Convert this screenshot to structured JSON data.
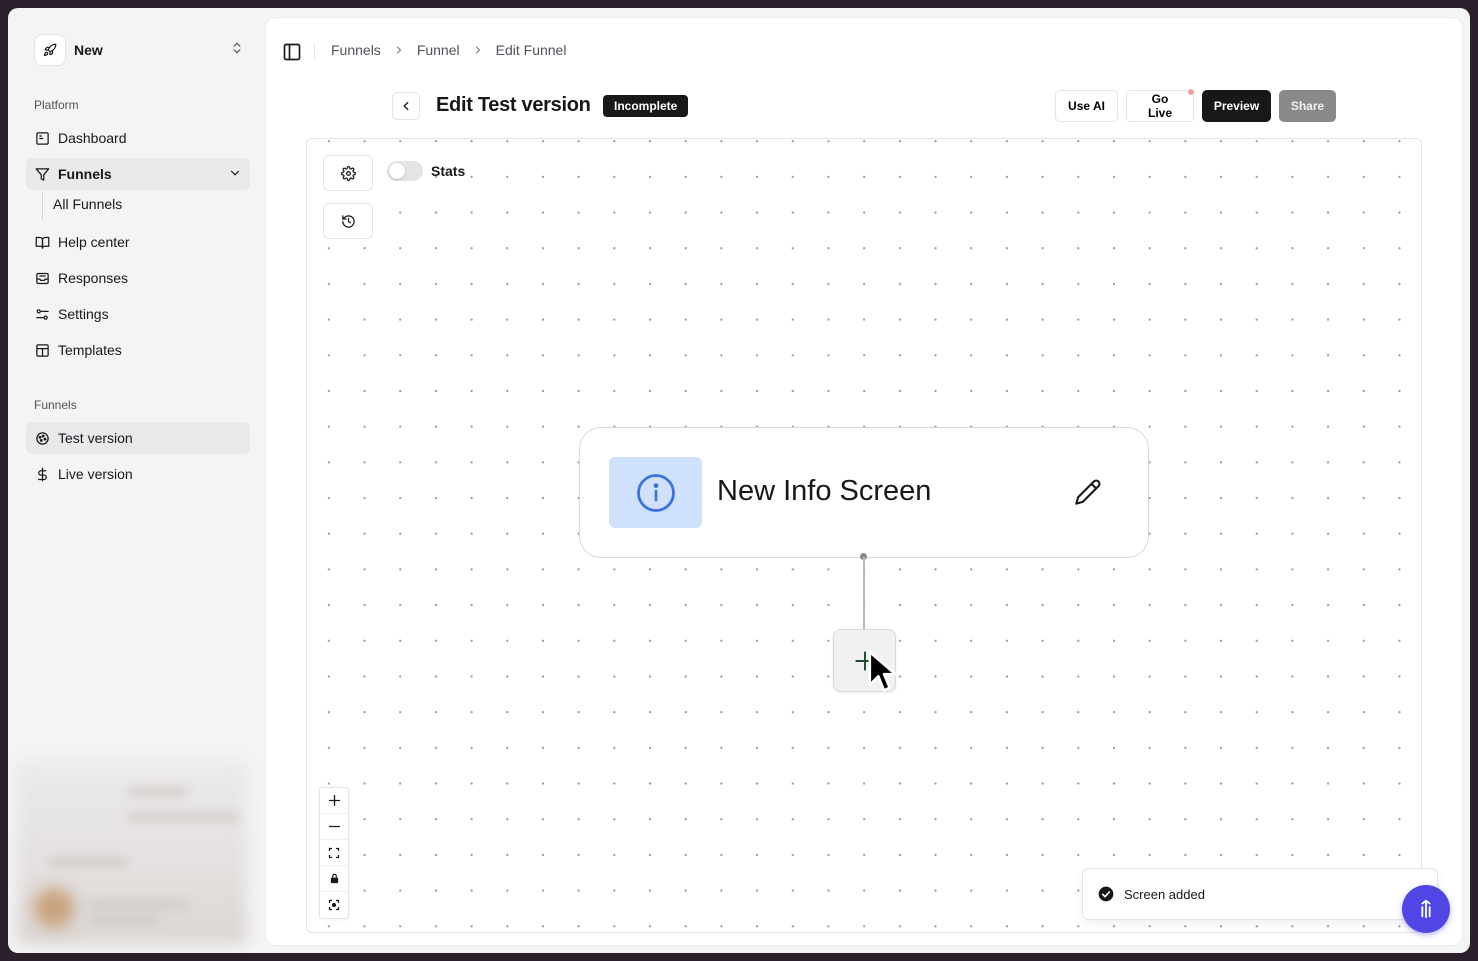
{
  "sidebar": {
    "team": {
      "name": "New"
    },
    "platform_label": "Platform",
    "platform_items": [
      {
        "label": "Dashboard",
        "icon": "dashboard-icon"
      },
      {
        "label": "Funnels",
        "icon": "filter-icon"
      },
      {
        "label": "All Funnels"
      },
      {
        "label": "Help center",
        "icon": "book-icon"
      },
      {
        "label": "Responses",
        "icon": "inbox-icon"
      },
      {
        "label": "Settings",
        "icon": "sliders-icon"
      },
      {
        "label": "Templates",
        "icon": "layout-icon"
      }
    ],
    "funnels_label": "Funnels",
    "funnel_items": [
      {
        "label": "Test version",
        "icon": "flask-icon"
      },
      {
        "label": "Live version",
        "icon": "dollar-icon"
      }
    ]
  },
  "header": {
    "breadcrumb": [
      "Funnels",
      "Funnel",
      "Edit Funnel"
    ],
    "title": "Edit Test version",
    "status_badge": "Incomplete",
    "actions": {
      "use_ai": "Use AI",
      "go_live": "Go Live",
      "preview": "Preview",
      "share": "Share"
    }
  },
  "canvas": {
    "stats_label": "Stats",
    "stats_enabled": false,
    "node": {
      "title": "New Info Screen",
      "icon": "info-icon"
    }
  },
  "toast": {
    "message": "Screen added"
  },
  "colors": {
    "accent": "#4f46e5",
    "node_icon_bg": "#cfe1fb",
    "info_icon": "#3b74e0",
    "badge_bg": "#18181b"
  }
}
